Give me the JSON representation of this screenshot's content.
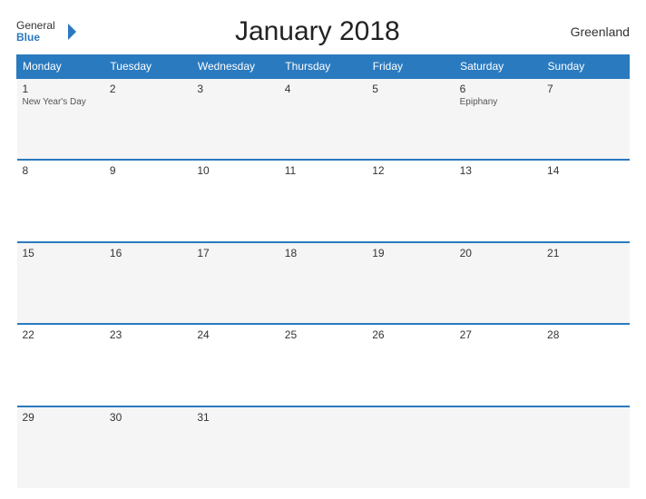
{
  "header": {
    "title": "January 2018",
    "region": "Greenland",
    "logo": {
      "general": "General",
      "blue": "Blue"
    }
  },
  "days_of_week": [
    "Monday",
    "Tuesday",
    "Wednesday",
    "Thursday",
    "Friday",
    "Saturday",
    "Sunday"
  ],
  "weeks": [
    [
      {
        "day": "1",
        "event": "New Year's Day"
      },
      {
        "day": "2",
        "event": ""
      },
      {
        "day": "3",
        "event": ""
      },
      {
        "day": "4",
        "event": ""
      },
      {
        "day": "5",
        "event": ""
      },
      {
        "day": "6",
        "event": "Epiphany"
      },
      {
        "day": "7",
        "event": ""
      }
    ],
    [
      {
        "day": "8",
        "event": ""
      },
      {
        "day": "9",
        "event": ""
      },
      {
        "day": "10",
        "event": ""
      },
      {
        "day": "11",
        "event": ""
      },
      {
        "day": "12",
        "event": ""
      },
      {
        "day": "13",
        "event": ""
      },
      {
        "day": "14",
        "event": ""
      }
    ],
    [
      {
        "day": "15",
        "event": ""
      },
      {
        "day": "16",
        "event": ""
      },
      {
        "day": "17",
        "event": ""
      },
      {
        "day": "18",
        "event": ""
      },
      {
        "day": "19",
        "event": ""
      },
      {
        "day": "20",
        "event": ""
      },
      {
        "day": "21",
        "event": ""
      }
    ],
    [
      {
        "day": "22",
        "event": ""
      },
      {
        "day": "23",
        "event": ""
      },
      {
        "day": "24",
        "event": ""
      },
      {
        "day": "25",
        "event": ""
      },
      {
        "day": "26",
        "event": ""
      },
      {
        "day": "27",
        "event": ""
      },
      {
        "day": "28",
        "event": ""
      }
    ],
    [
      {
        "day": "29",
        "event": ""
      },
      {
        "day": "30",
        "event": ""
      },
      {
        "day": "31",
        "event": ""
      },
      {
        "day": "",
        "event": ""
      },
      {
        "day": "",
        "event": ""
      },
      {
        "day": "",
        "event": ""
      },
      {
        "day": "",
        "event": ""
      }
    ]
  ]
}
